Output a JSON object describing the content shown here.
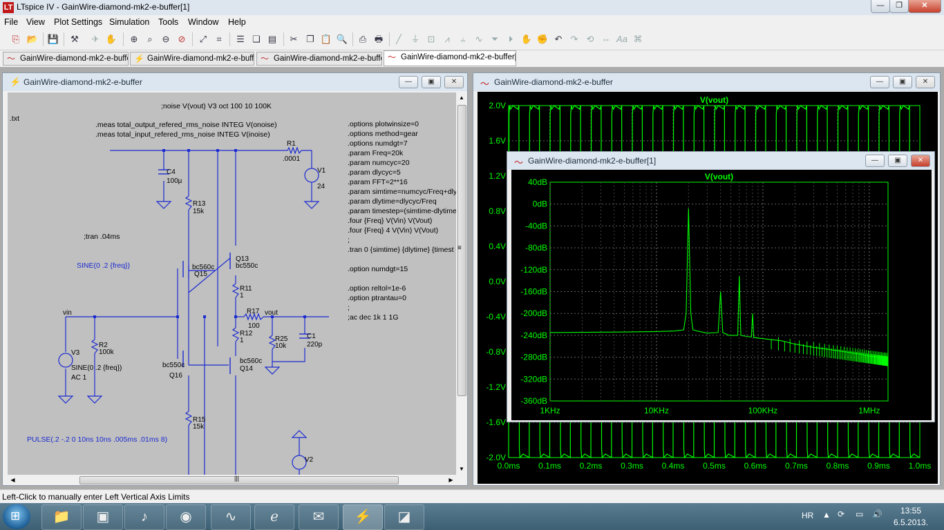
{
  "window": {
    "title": "LTspice IV - GainWire-diamond-mk2-e-buffer[1]",
    "app_icon": "LT",
    "minimize": "—",
    "maximize": "❐",
    "close": "✕"
  },
  "menu": [
    "File",
    "View",
    "Plot Settings",
    "Simulation",
    "Tools",
    "Window",
    "Help"
  ],
  "tabs": [
    {
      "label": "GainWire-diamond-mk2-e-buffer",
      "icon": "waveform-icon"
    },
    {
      "label": "GainWire-diamond-mk2-e-buffer",
      "icon": "schematic-icon"
    },
    {
      "label": "GainWire-diamond-mk2-e-buffer",
      "icon": "waveform-icon"
    },
    {
      "label": "GainWire-diamond-mk2-e-buffer[1]",
      "icon": "waveform-icon",
      "active": true
    }
  ],
  "schematic": {
    "title": "GainWire-diamond-mk2-e-buffer",
    "directives_top": [
      ";noise V(vout) V3 oct 100 10 100K",
      ".txt",
      ".meas total_output_refered_rms_noise INTEG V(onoise)",
      ".meas total_input_refered_rms_noise INTEG V(inoise)"
    ],
    "directives_right": [
      ".options plotwinsize=0",
      ".options method=gear",
      ".options numdgt=7",
      ".param Freq=20k",
      ".param numcyc=20",
      ".param dlycyc=5",
      ".param FFT=2**16",
      ".param simtime=numcyc/Freq+dly",
      ".param dlytime=dlycyc/Freq",
      ".param timestep=(simtime-dlytime",
      ".four {Freq} V(Vin) V(Vout)",
      ".four {Freq} 4 V(Vin) V(Vout)",
      ";",
      ".tran 0 {simtime} {dlytime} {timest",
      "",
      ".option numdgt=15",
      "",
      ".option reltol=1e-6",
      ".option ptrantau=0",
      ";",
      ";ac dec 1k 1 1G"
    ],
    "tran_comment": ";tran .04ms",
    "sine_label": "SINE(0 .2 {freq})",
    "pulse_label": "PULSE(.2 -.2 0 10ns 10ns .005ms .01ms 8)",
    "components": {
      "R1": {
        "name": "R1",
        "value": ".0001"
      },
      "V1": {
        "name": "V1",
        "value": "24"
      },
      "C4": {
        "name": "C4",
        "value": "100µ"
      },
      "R13": {
        "name": "R13",
        "value": "15k"
      },
      "Q13": {
        "name": "Q13",
        "value": "bc550c"
      },
      "Q15": {
        "name": "Q15",
        "value": "bc560c"
      },
      "R11": {
        "name": "R11",
        "value": "1"
      },
      "R17": {
        "name": "R17",
        "value": "100"
      },
      "R12": {
        "name": "R12",
        "value": "1"
      },
      "R25": {
        "name": "R25",
        "value": "10k"
      },
      "C1": {
        "name": "C1",
        "value": "220p"
      },
      "R2": {
        "name": "R2",
        "value": "100k"
      },
      "V3": {
        "name": "V3",
        "value": "SINE(0 .2 {freq})",
        "ac": "AC 1"
      },
      "Q16": {
        "name": "Q16",
        "value": "bc550c"
      },
      "Q14": {
        "name": "Q14",
        "value": "bc560c"
      },
      "R15": {
        "name": "R15",
        "value": "15k"
      },
      "V2": {
        "name": "V2",
        "value": "24"
      }
    },
    "net_vin": "vin",
    "net_vout": "vout",
    "hscroll_grip": "|||",
    "vscroll_grip": "≡"
  },
  "waveform_back": {
    "title": "GainWire-diamond-mk2-e-buffer",
    "trace": "V(vout)",
    "y_ticks": [
      "2.0V",
      "1.6V",
      "1.2V",
      "0.8V",
      "0.4V",
      "0.0V",
      "-0.4V",
      "-0.8V",
      "-1.2V",
      "-1.6V",
      "-2.0V"
    ],
    "x_ticks": [
      "0.0ms",
      "0.1ms",
      "0.2ms",
      "0.3ms",
      "0.4ms",
      "0.5ms",
      "0.6ms",
      "0.7ms",
      "0.8ms",
      "0.9ms",
      "1.0ms"
    ],
    "trace_color": "#00ff00"
  },
  "waveform_front": {
    "title": "GainWire-diamond-mk2-e-buffer[1]",
    "trace": "V(vout)",
    "y_ticks": [
      "40dB",
      "0dB",
      "-40dB",
      "-80dB",
      "-120dB",
      "-160dB",
      "-200dB",
      "-240dB",
      "-280dB",
      "-320dB",
      "-360dB"
    ],
    "x_ticks": [
      "1KHz",
      "10KHz",
      "100KHz",
      "1MHz"
    ],
    "trace_color": "#00ff00"
  },
  "chart_data": [
    {
      "type": "line",
      "title": "V(vout)",
      "x_unit": "ms",
      "xlim": [
        0,
        1.0
      ],
      "ylim": [
        -2.0,
        2.0
      ],
      "y_unit": "V",
      "series": [
        {
          "name": "V(vout)",
          "description": "pulse waveform ±2V, period 0.05ms",
          "period_ms": 0.05,
          "high": 2.0,
          "low": -2.0
        }
      ]
    },
    {
      "type": "line",
      "title": "V(vout)",
      "x_scale": "log",
      "xlim_hz": [
        1000,
        1500000
      ],
      "ylim_db": [
        -360,
        40
      ],
      "series": [
        {
          "name": "V(vout)",
          "x": [
            1000,
            5000,
            10000,
            15000,
            18000,
            19000,
            20000,
            21000,
            22000,
            24000,
            30000,
            38000,
            40000,
            42000,
            48000,
            58000,
            60000,
            62000,
            70000,
            78000,
            80000,
            82000,
            100000,
            150000,
            200000,
            300000,
            500000,
            800000,
            1000000,
            1500000
          ],
          "y": [
            -235,
            -234,
            -233,
            -232,
            -230,
            -200,
            -8,
            -200,
            -230,
            -232,
            -236,
            -235,
            -160,
            -235,
            -240,
            -240,
            -132,
            -240,
            -242,
            -243,
            -200,
            -244,
            -246,
            -250,
            -256,
            -262,
            -268,
            -274,
            -278,
            -282
          ]
        }
      ]
    }
  ],
  "status": "Left-Click to manually enter Left Vertical Axis Limits",
  "taskbar": {
    "start_icon": "windows-start-icon",
    "apps": [
      "explorer-icon",
      "media-icon",
      "sound-icon",
      "torrent-icon",
      "scope-icon",
      "ie-icon",
      "notes-icon",
      "ltspice-icon",
      "paint-icon"
    ],
    "lang": "HR",
    "time": "13:55",
    "date": "6.5.2013."
  }
}
